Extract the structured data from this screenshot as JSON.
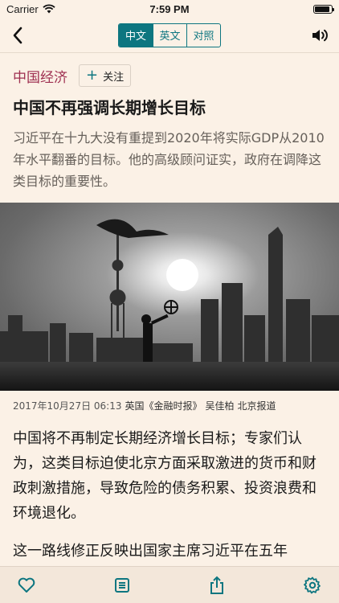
{
  "status_bar": {
    "carrier": "Carrier",
    "time": "7:59 PM",
    "battery_level": 0.92
  },
  "nav": {
    "segments": [
      {
        "label": "中文",
        "active": true
      },
      {
        "label": "英文",
        "active": false
      },
      {
        "label": "对照",
        "active": false
      }
    ]
  },
  "article": {
    "topic": "中国经济",
    "follow_label": "关注",
    "headline": "中国不再强调长期增长目标",
    "standfirst": "习近平在十九大没有重提到2020年将实际GDP从2010年水平翻番的目标。他的高级顾问证实，政府在调降这类目标的重要性。",
    "byline": {
      "date": "2017年10月27日 06:13",
      "source": "英国《金融时报》",
      "author": "吴佳柏",
      "location": "北京报道"
    },
    "paragraphs": [
      "中国将不再制定长期经济增长目标；专家们认为，这类目标迫使北京方面采取激进的货币和财政刺激措施，导致危险的债务积累、投资浪费和环境退化。",
      "这一路线修正反映出国家主席习近平在五年"
    ]
  },
  "colors": {
    "accent": "#0d7680",
    "topic": "#9e2f50",
    "background": "#fbf1e6"
  },
  "toolbar": {
    "icons": [
      "heart-icon",
      "list-icon",
      "share-icon",
      "gear-icon"
    ]
  }
}
